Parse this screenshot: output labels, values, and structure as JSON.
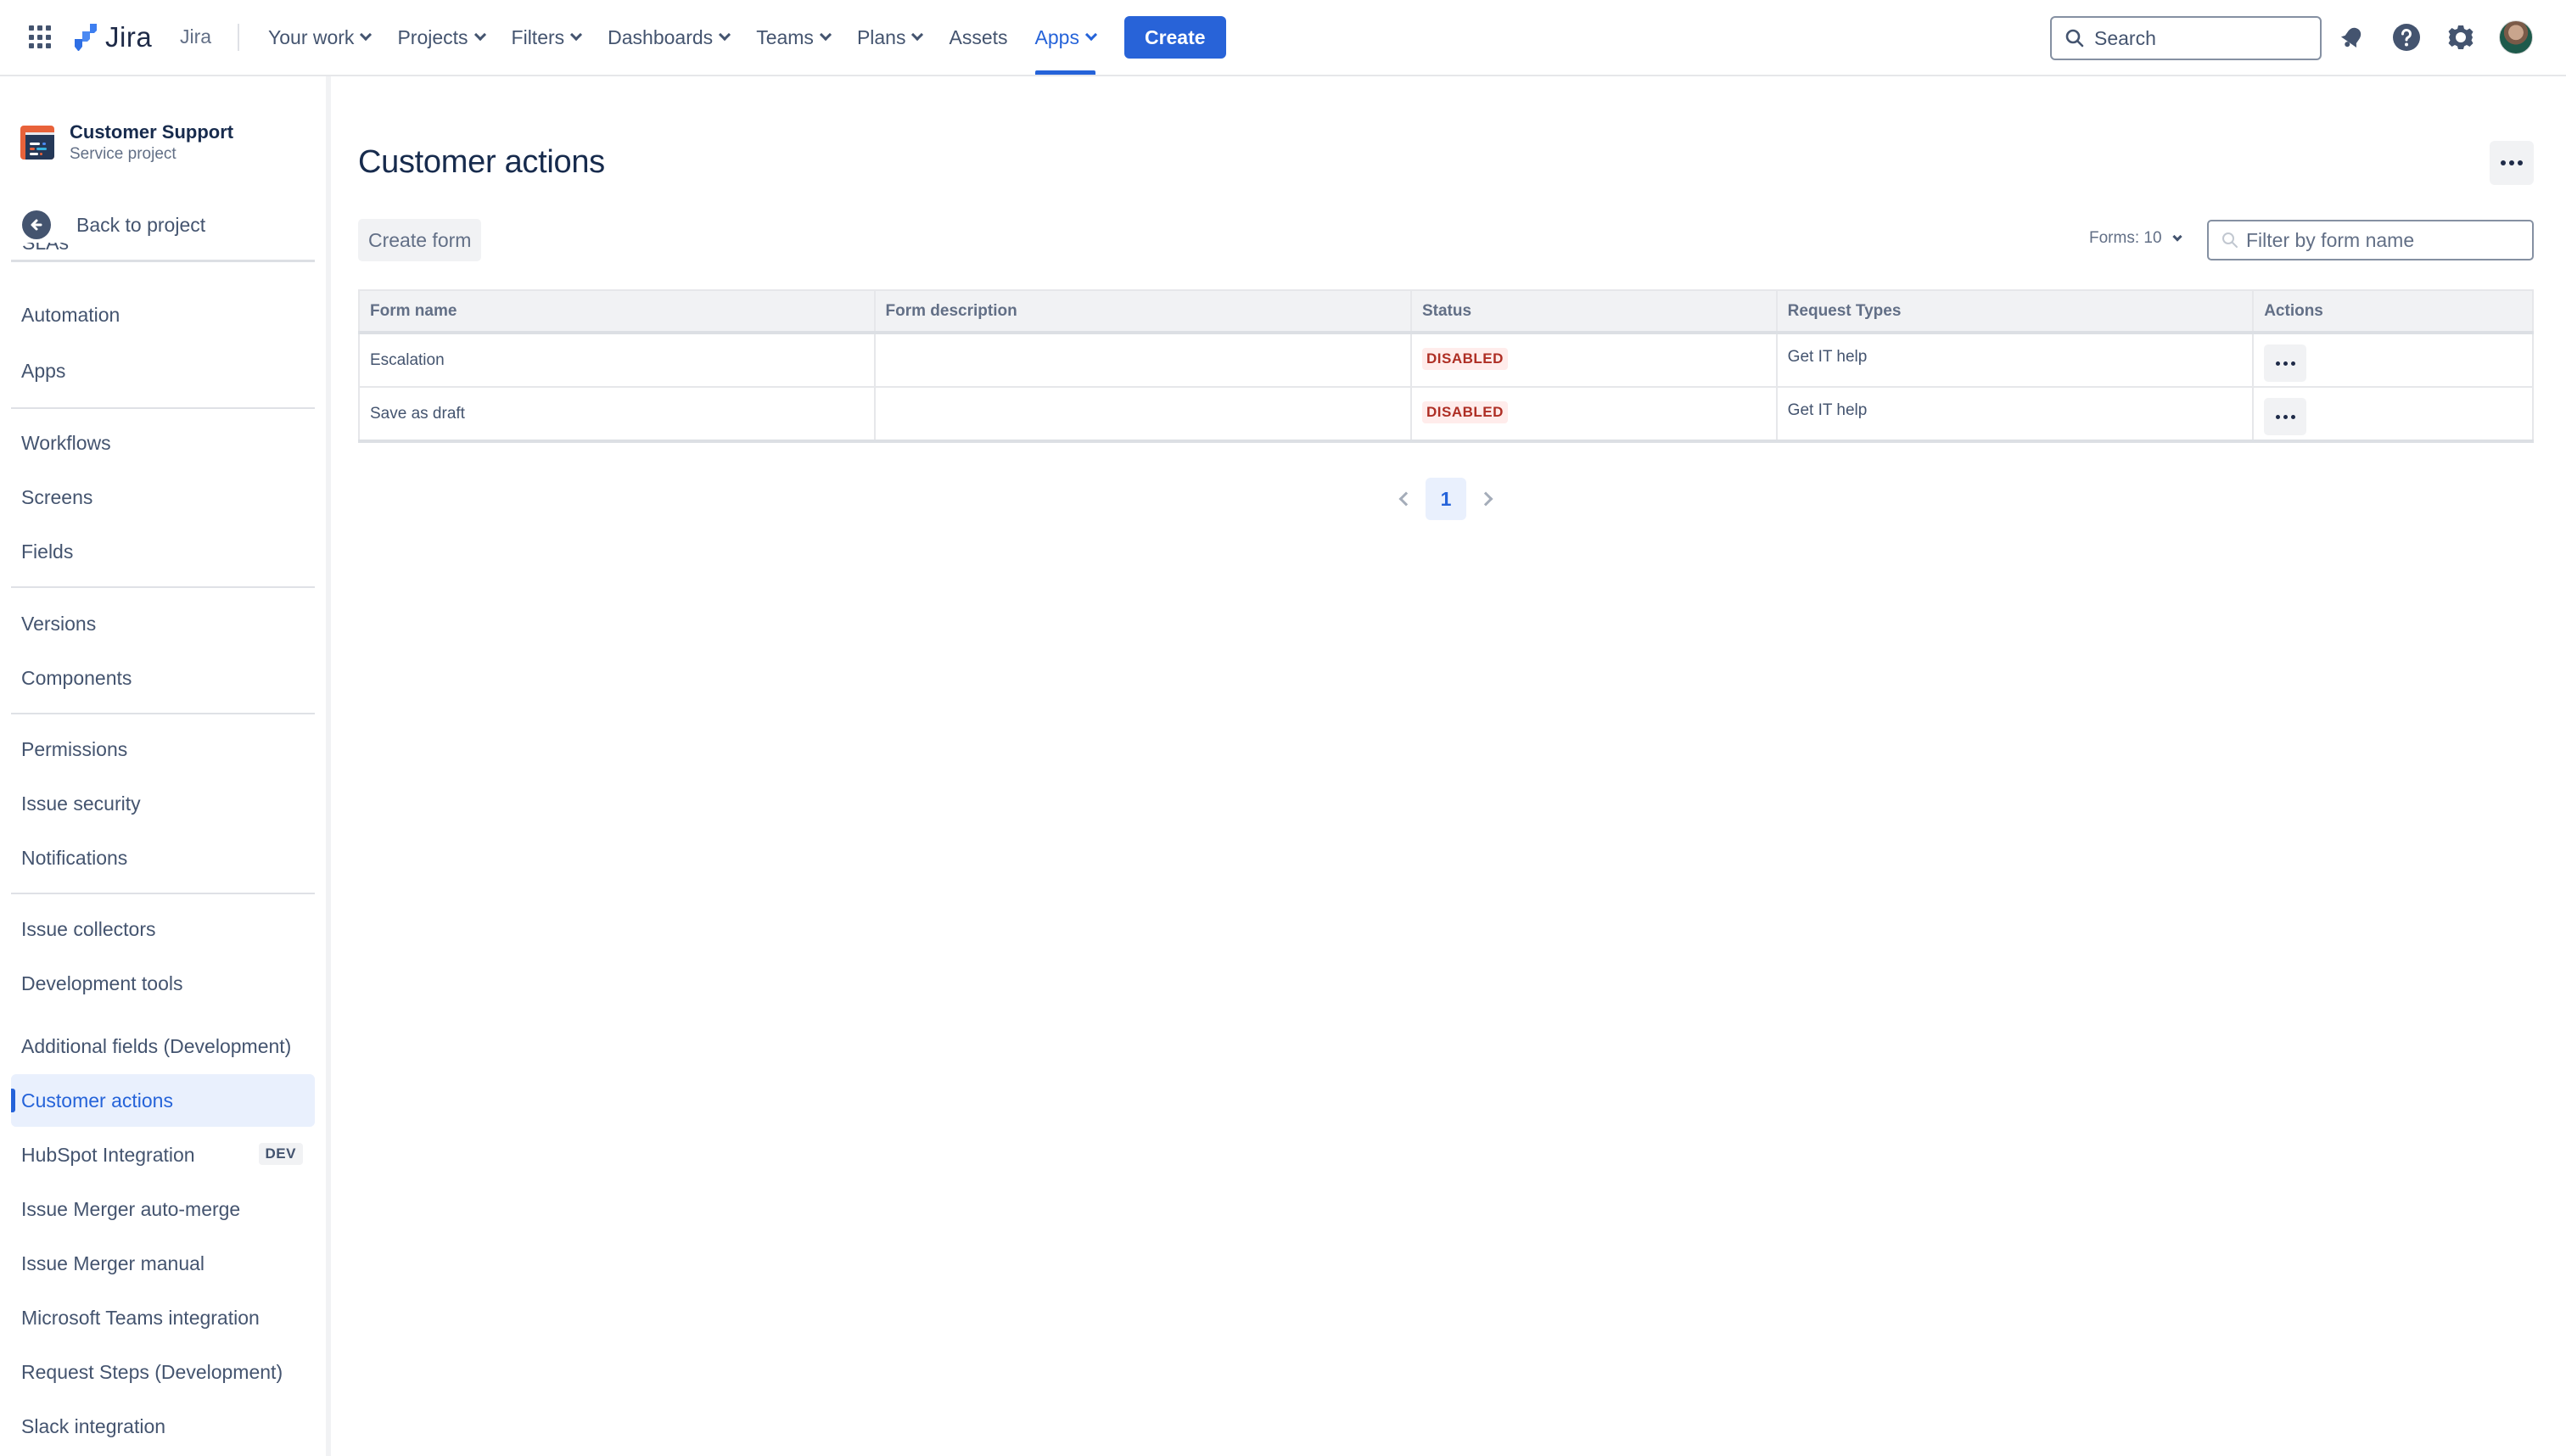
{
  "topnav": {
    "logo_text": "Jira",
    "product_name": "Jira",
    "items": [
      {
        "label": "Your work",
        "has_dropdown": true,
        "active": false
      },
      {
        "label": "Projects",
        "has_dropdown": true,
        "active": false
      },
      {
        "label": "Filters",
        "has_dropdown": true,
        "active": false
      },
      {
        "label": "Dashboards",
        "has_dropdown": true,
        "active": false
      },
      {
        "label": "Teams",
        "has_dropdown": true,
        "active": false
      },
      {
        "label": "Plans",
        "has_dropdown": true,
        "active": false
      },
      {
        "label": "Assets",
        "has_dropdown": false,
        "active": false
      },
      {
        "label": "Apps",
        "has_dropdown": true,
        "active": true
      }
    ],
    "create_label": "Create",
    "search_placeholder": "Search",
    "icons": [
      "notifications-icon",
      "help-icon",
      "settings-icon",
      "avatar"
    ],
    "accent_color": "#2563d9"
  },
  "sidebar": {
    "project_name": "Customer Support",
    "project_type": "Service project",
    "back_label": "Back to project",
    "partial_item": "SLAs",
    "groups": [
      [
        {
          "label": "Automation"
        },
        {
          "label": "Apps"
        }
      ],
      [
        {
          "label": "Workflows"
        },
        {
          "label": "Screens"
        },
        {
          "label": "Fields"
        }
      ],
      [
        {
          "label": "Versions"
        },
        {
          "label": "Components"
        }
      ],
      [
        {
          "label": "Permissions"
        },
        {
          "label": "Issue security"
        },
        {
          "label": "Notifications"
        }
      ],
      [
        {
          "label": "Issue collectors"
        },
        {
          "label": "Development tools"
        }
      ],
      [
        {
          "label": "Additional fields (Development)"
        },
        {
          "label": "Customer actions",
          "active": true
        },
        {
          "label": "HubSpot Integration",
          "badge": "DEV"
        },
        {
          "label": "Issue Merger auto-merge"
        },
        {
          "label": "Issue Merger manual"
        },
        {
          "label": "Microsoft Teams integration"
        },
        {
          "label": "Request Steps (Development)"
        },
        {
          "label": "Slack integration"
        }
      ]
    ]
  },
  "main": {
    "title": "Customer actions",
    "create_form_label": "Create form",
    "forms_count_label": "Forms: 10",
    "filter_placeholder": "Filter by form name",
    "filter_value": "",
    "table": {
      "columns": [
        "Form name",
        "Form description",
        "Status",
        "Request Types",
        "Actions"
      ],
      "rows": [
        {
          "name": "Escalation",
          "description": "",
          "status": "DISABLED",
          "request_types": "Get IT help"
        },
        {
          "name": "Save as draft",
          "description": "",
          "status": "DISABLED",
          "request_types": "Get IT help"
        }
      ]
    },
    "pagination": {
      "current_page": "1",
      "pages": [
        "1"
      ]
    },
    "status_color": "#ae2e24",
    "status_bg": "#ffeceb"
  }
}
